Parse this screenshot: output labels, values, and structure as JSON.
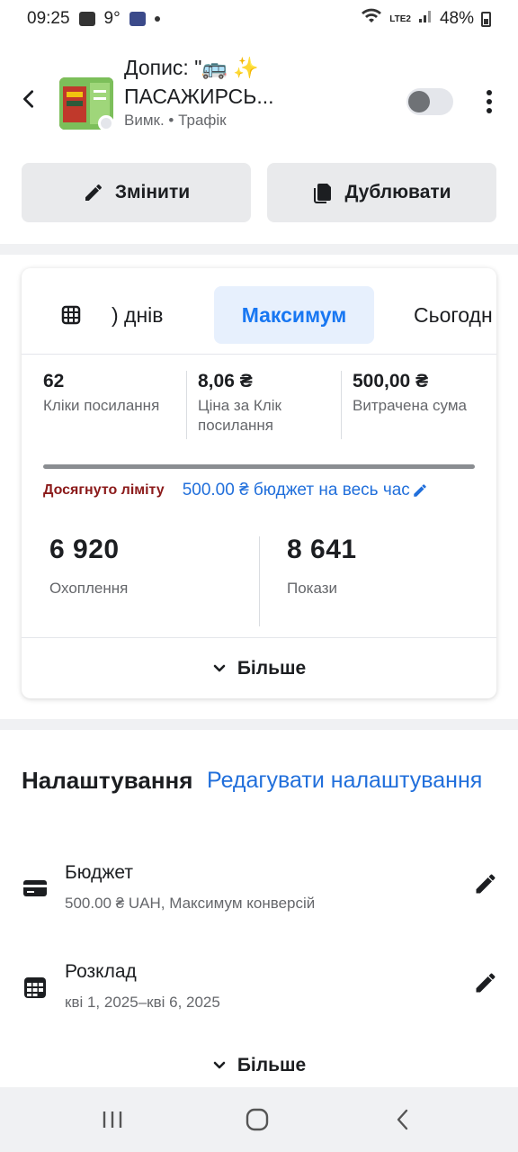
{
  "status_bar": {
    "time": "09:25",
    "temp": "9°",
    "network": "LTE2",
    "battery": "48%"
  },
  "header": {
    "title_line1": "Допис: \"🚌 ✨",
    "title_line2": "ПАСАЖИРСЬ...",
    "subtitle": "Вимк. • Трафік",
    "toggle_on": false
  },
  "actions": {
    "edit_label": "Змінити",
    "duplicate_label": "Дублювати"
  },
  "stats": {
    "tabs": {
      "days": ") днів",
      "max": "Максимум",
      "today": "Сьогодн"
    },
    "metrics": [
      {
        "value": "62",
        "label": "Кліки посилання"
      },
      {
        "value": "8,06 ₴",
        "label": "Ціна за Клік посилання"
      },
      {
        "value": "500,00 ₴",
        "label": "Витрачена сума"
      }
    ],
    "progress_fraction": 1.0,
    "limit_label": "Досягнуто ліміту",
    "budget_label": "500.00 ₴ бюджет на весь час",
    "reach_value": "6 920",
    "reach_label": "Охоплення",
    "impressions_value": "8 641",
    "impressions_label": "Покази",
    "more_label": "Більше"
  },
  "settings": {
    "title": "Налаштування",
    "edit_link": "Редагувати налаштування",
    "budget_name": "Бюджет",
    "budget_detail": "500.00 ₴ UAH, Максимум конверсій",
    "schedule_name": "Розклад",
    "schedule_detail": "кві 1, 2025–кві 6, 2025",
    "more_label": "Більше"
  },
  "colors": {
    "accent": "#216fdb",
    "limit_red": "#8b1a1a",
    "tab_active_bg": "#e7f0fd"
  }
}
